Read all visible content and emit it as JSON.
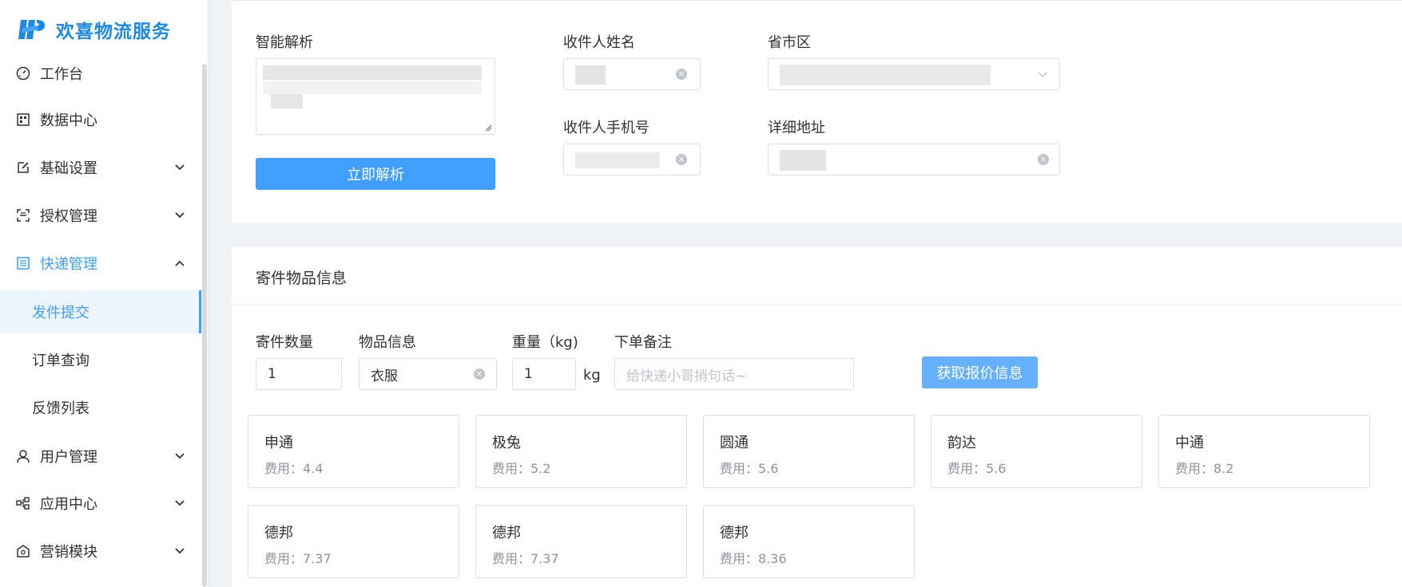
{
  "brand": {
    "name": "欢喜物流服务"
  },
  "sidebar": {
    "items": [
      {
        "label": "工作台",
        "icon": "dashboard-icon"
      },
      {
        "label": "数据中心",
        "icon": "data-center-icon"
      },
      {
        "label": "基础设置",
        "icon": "edit-icon"
      },
      {
        "label": "授权管理",
        "icon": "scan-icon"
      },
      {
        "label": "快递管理",
        "icon": "list-icon"
      },
      {
        "label": "用户管理",
        "icon": "user-icon"
      },
      {
        "label": "应用中心",
        "icon": "app-center-icon"
      },
      {
        "label": "营销模块",
        "icon": "marketing-icon"
      }
    ],
    "submenu": [
      {
        "label": "发件提交",
        "active": true
      },
      {
        "label": "订单查询"
      },
      {
        "label": "反馈列表"
      }
    ]
  },
  "recipient": {
    "smart_parse_label": "智能解析",
    "parse_button": "立即解析",
    "name_label": "收件人姓名",
    "region_label": "省市区",
    "phone_label": "收件人手机号",
    "address_label": "详细地址"
  },
  "items": {
    "section_title": "寄件物品信息",
    "quantity_label": "寄件数量",
    "quantity_value": "1",
    "goods_label": "物品信息",
    "goods_value": "衣服",
    "weight_label": "重量（kg)",
    "weight_value": "1",
    "weight_unit": "kg",
    "remark_label": "下单备注",
    "remark_placeholder": "给快递小哥捎句话~",
    "quote_button": "获取报价信息"
  },
  "quotes": [
    {
      "carrier": "申通",
      "fee": "费用：4.4"
    },
    {
      "carrier": "极兔",
      "fee": "费用：5.2"
    },
    {
      "carrier": "圆通",
      "fee": "费用：5.6"
    },
    {
      "carrier": "韵达",
      "fee": "费用：5.6"
    },
    {
      "carrier": "中通",
      "fee": "费用：8.2"
    },
    {
      "carrier": "德邦",
      "fee": "费用：7.37"
    },
    {
      "carrier": "德邦",
      "fee": "费用：7.37"
    },
    {
      "carrier": "德邦",
      "fee": "费用：8.36"
    }
  ],
  "colors": {
    "primary": "#409eff",
    "brand": "#1e88e5"
  }
}
